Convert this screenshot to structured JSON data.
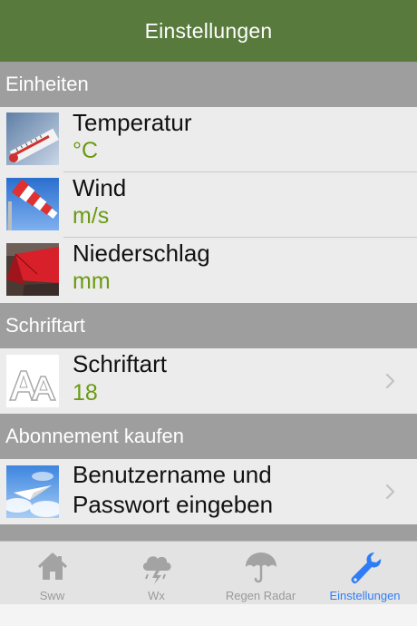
{
  "navbar": {
    "title": "Einstellungen"
  },
  "sections": {
    "units": {
      "header": "Einheiten",
      "rows": [
        {
          "label": "Temperatur",
          "value": "°C"
        },
        {
          "label": "Wind",
          "value": "m/s"
        },
        {
          "label": "Niederschlag",
          "value": "mm"
        }
      ]
    },
    "font": {
      "header": "Schriftart",
      "rows": [
        {
          "label": "Schriftart",
          "value": "18"
        }
      ]
    },
    "subscription": {
      "header": "Abonnement kaufen",
      "rows": [
        {
          "label_line1": "Benutzername und",
          "label_line2": "Passwort eingeben"
        }
      ]
    }
  },
  "tabs": [
    {
      "label": "Sww",
      "icon": "house-icon",
      "active": false
    },
    {
      "label": "Wx",
      "icon": "storm-cloud-icon",
      "active": false
    },
    {
      "label": "Regen Radar",
      "icon": "umbrella-icon",
      "active": false
    },
    {
      "label": "Einstellungen",
      "icon": "wrench-icon",
      "active": true
    }
  ],
  "colors": {
    "navbar": "#587a3c",
    "section_header": "#9e9e9e",
    "value_green": "#6b9a12",
    "tab_active": "#2f7df6",
    "tab_inactive": "#9a9a9a"
  }
}
